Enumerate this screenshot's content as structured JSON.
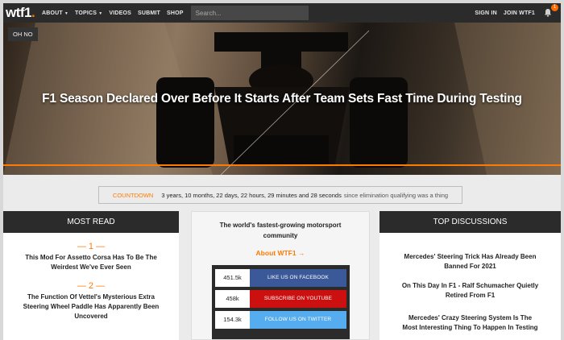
{
  "nav": {
    "logo": "wtf1",
    "logo_dot": ".",
    "about": "ABOUT",
    "topics": "TOPICS",
    "videos": "VIDEOS",
    "submit": "SUBMIT",
    "shop": "SHOP",
    "search_placeholder": "Search...",
    "sign_in": "SIGN IN",
    "join": "JOIN WTF1",
    "notification_count": "1",
    "caret_icon": "chevron-down-icon",
    "bell_icon": "bell-icon"
  },
  "hero": {
    "tag": "OH NO",
    "title": "F1 Season Declared Over Before It Starts After Team Sets Fast Time During Testing"
  },
  "countdown": {
    "label": "COUNTDOWN",
    "time": "3 years, 10 months, 22 days, 22 hours, 29 minutes and 28 seconds",
    "suffix": "since elimination qualifying was a thing"
  },
  "most_read": {
    "title": "MOST READ",
    "items": [
      {
        "num": "— 1 —",
        "title": "This Mod For Assetto Corsa Has To Be The Weirdest We've Ever Seen"
      },
      {
        "num": "— 2 —",
        "title": "The Function Of Vettel's Mysterious Extra Steering Wheel Paddle Has Apparently Been Uncovered"
      }
    ]
  },
  "community": {
    "text": "The world's fastest-growing motorsport community",
    "about_link": "About WTF1 →",
    "social": [
      {
        "count": "451.5k",
        "label": "LIKE US ON FACEBOOK",
        "color": "#3b5998"
      },
      {
        "count": "458k",
        "label": "SUBSCRIBE ON YOUTUBE",
        "color": "#cc1010"
      },
      {
        "count": "154.3k",
        "label": "FOLLOW US ON TWITTER",
        "color": "#55acee"
      }
    ]
  },
  "discussions": {
    "title": "TOP DISCUSSIONS",
    "items": [
      "Mercedes' Steering Trick Has Already Been Banned For 2021",
      "On This Day In F1 - Ralf Schumacher Quietly Retired From F1",
      "Mercedes' Crazy Steering System Is The Most Interesting Thing To Happen In Testing"
    ]
  },
  "colors": {
    "accent": "#ff7a00",
    "dark": "#2b2b2b",
    "facebook": "#3b5998",
    "youtube": "#cc1010",
    "twitter": "#55acee"
  }
}
